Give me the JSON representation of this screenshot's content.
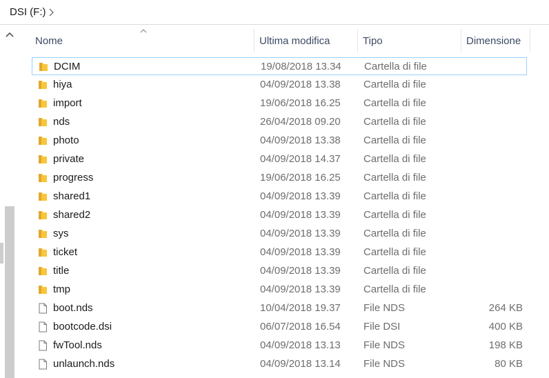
{
  "breadcrumb": {
    "location": "DSI (F:)"
  },
  "columns": {
    "name": "Nome",
    "modified": "Ultima modifica",
    "type": "Tipo",
    "size": "Dimensione"
  },
  "items": [
    {
      "name": "DCIM",
      "modified": "19/08/2018 13.34",
      "type": "Cartella di file",
      "size": "",
      "kind": "folder",
      "selected": true
    },
    {
      "name": "hiya",
      "modified": "04/09/2018 13.38",
      "type": "Cartella di file",
      "size": "",
      "kind": "folder"
    },
    {
      "name": "import",
      "modified": "19/06/2018 16.25",
      "type": "Cartella di file",
      "size": "",
      "kind": "folder"
    },
    {
      "name": "nds",
      "modified": "26/04/2018 09.20",
      "type": "Cartella di file",
      "size": "",
      "kind": "folder"
    },
    {
      "name": "photo",
      "modified": "04/09/2018 13.38",
      "type": "Cartella di file",
      "size": "",
      "kind": "folder"
    },
    {
      "name": "private",
      "modified": "04/09/2018 14.37",
      "type": "Cartella di file",
      "size": "",
      "kind": "folder"
    },
    {
      "name": "progress",
      "modified": "19/06/2018 16.25",
      "type": "Cartella di file",
      "size": "",
      "kind": "folder"
    },
    {
      "name": "shared1",
      "modified": "04/09/2018 13.39",
      "type": "Cartella di file",
      "size": "",
      "kind": "folder"
    },
    {
      "name": "shared2",
      "modified": "04/09/2018 13.39",
      "type": "Cartella di file",
      "size": "",
      "kind": "folder"
    },
    {
      "name": "sys",
      "modified": "04/09/2018 13.39",
      "type": "Cartella di file",
      "size": "",
      "kind": "folder"
    },
    {
      "name": "ticket",
      "modified": "04/09/2018 13.39",
      "type": "Cartella di file",
      "size": "",
      "kind": "folder"
    },
    {
      "name": "title",
      "modified": "04/09/2018 13.39",
      "type": "Cartella di file",
      "size": "",
      "kind": "folder"
    },
    {
      "name": "tmp",
      "modified": "04/09/2018 13.39",
      "type": "Cartella di file",
      "size": "",
      "kind": "folder"
    },
    {
      "name": "boot.nds",
      "modified": "10/04/2018 19.37",
      "type": "File NDS",
      "size": "264 KB",
      "kind": "file"
    },
    {
      "name": "bootcode.dsi",
      "modified": "06/07/2018 16.54",
      "type": "File DSI",
      "size": "400 KB",
      "kind": "file"
    },
    {
      "name": "fwTool.nds",
      "modified": "04/09/2018 13.13",
      "type": "File NDS",
      "size": "198 KB",
      "kind": "file"
    },
    {
      "name": "unlaunch.nds",
      "modified": "04/09/2018 13.14",
      "type": "File NDS",
      "size": "80 KB",
      "kind": "file"
    }
  ],
  "colors": {
    "folder": "#f8c63d",
    "folder_dark": "#e2a72c",
    "selection_border": "#99d1ff",
    "header_text": "#3b4a63",
    "secondary_text": "#6d6d6d"
  },
  "icons": {
    "folder": "folder-icon",
    "file": "file-icon",
    "scroll_up": "chevron-up-icon",
    "breadcrumb_separator": "chevron-right-icon",
    "sort": "sort-ascending-icon"
  }
}
